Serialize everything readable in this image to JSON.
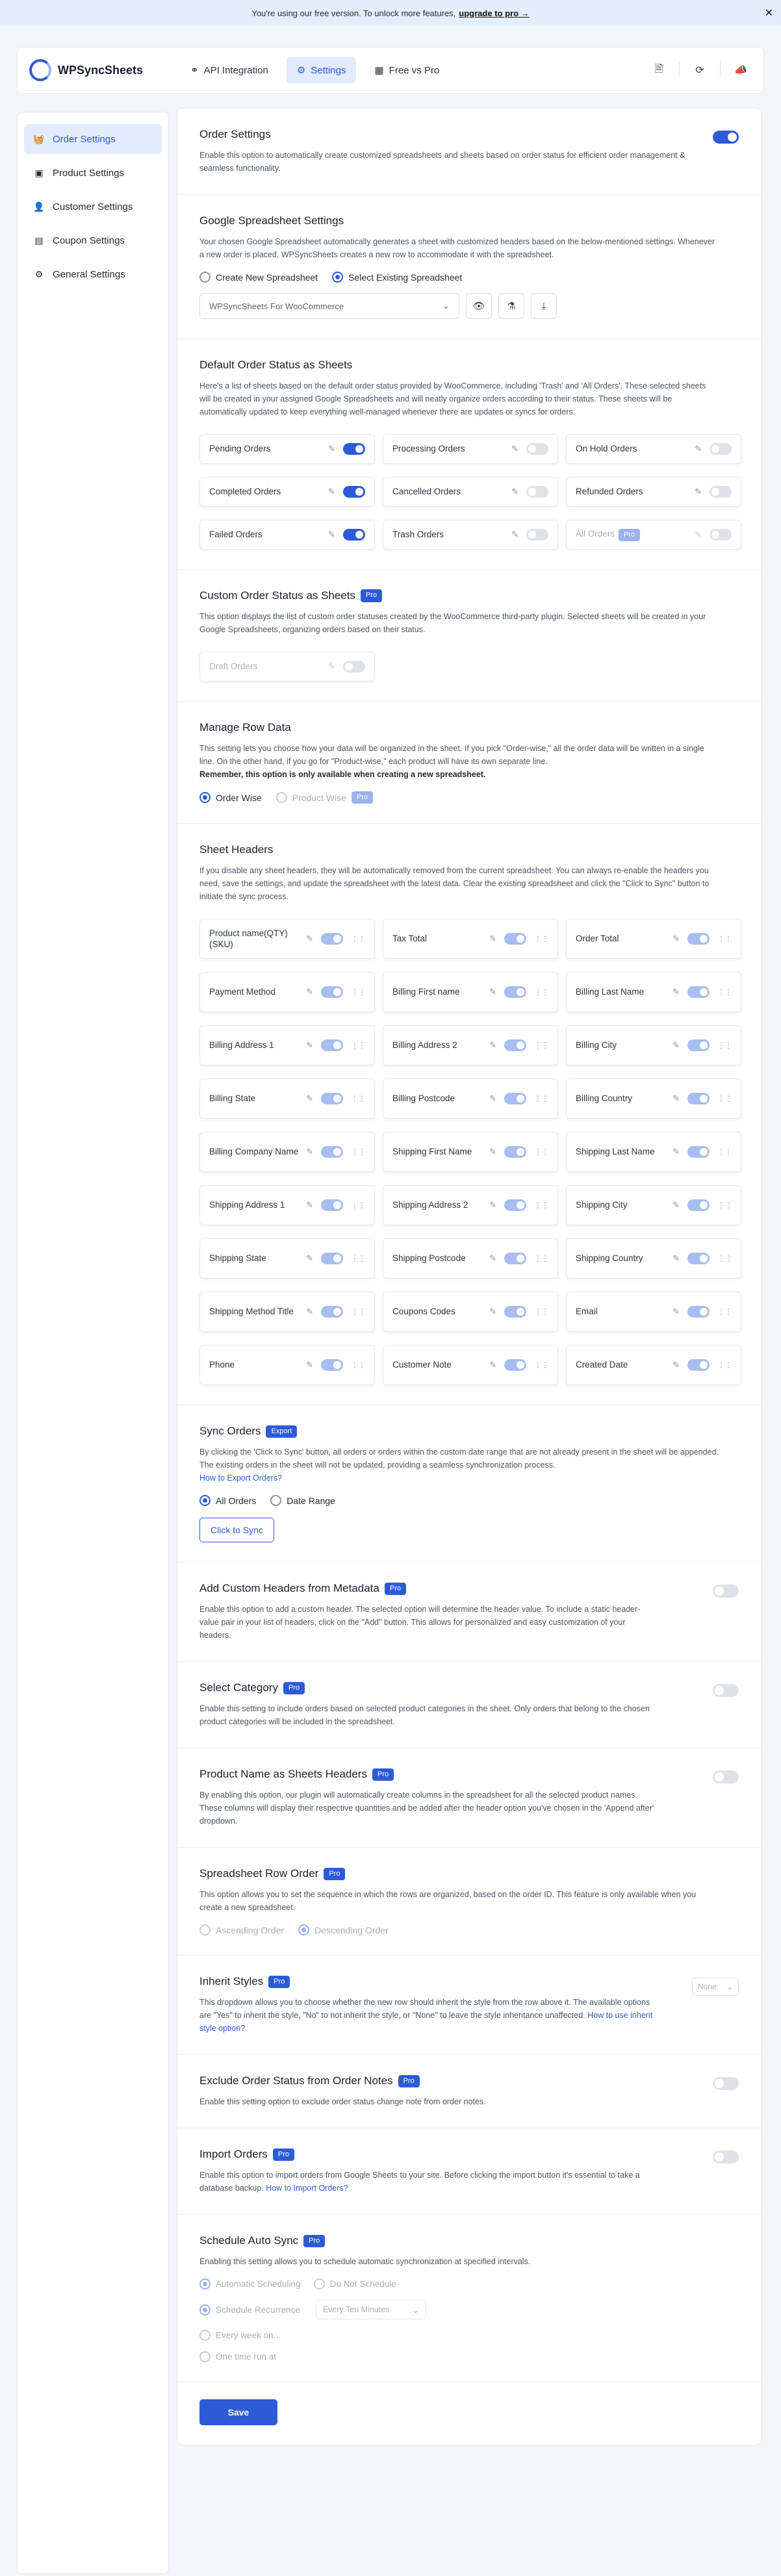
{
  "banner": {
    "text": "You're using our free version. To unlock more features,",
    "link": "upgrade to pro →",
    "close": "✕"
  },
  "app": {
    "name": "WPSyncSheets"
  },
  "nav": [
    {
      "label": "API Integration",
      "icon": "link-icon",
      "glyph": "⚭"
    },
    {
      "label": "Settings",
      "icon": "gear-icon",
      "glyph": "⚙"
    },
    {
      "label": "Free vs Pro",
      "icon": "grid-icon",
      "glyph": "▦"
    }
  ],
  "header_icons": [
    {
      "name": "document-icon",
      "glyph": "🗎"
    },
    {
      "name": "refresh-icon",
      "glyph": "⟳"
    },
    {
      "name": "megaphone-icon",
      "glyph": "📣"
    }
  ],
  "sidebar": [
    {
      "label": "Order Settings",
      "icon": "basket-icon",
      "glyph": "🧺"
    },
    {
      "label": "Product Settings",
      "icon": "product-icon",
      "glyph": "▣"
    },
    {
      "label": "Customer Settings",
      "icon": "user-icon",
      "glyph": "👤"
    },
    {
      "label": "Coupon Settings",
      "icon": "coupon-icon",
      "glyph": "▤"
    },
    {
      "label": "General Settings",
      "icon": "gear-icon",
      "glyph": "⚙"
    }
  ],
  "order_settings": {
    "title": "Order Settings",
    "desc": "Enable this option to automatically create customized spreadsheets and sheets based on order status for efficient order management & seamless functionality.",
    "enabled": true
  },
  "google": {
    "title": "Google Spreadsheet Settings",
    "desc": "Your chosen Google Spreadsheet automatically generates a sheet with customized headers based on the below-mentioned settings. Whenever a new order is placed, WPSyncSheets creates a new row to accommodate it with the spreadsheet.",
    "radio_new": "Create New Spreadsheet",
    "radio_existing": "Select Existing Spreadsheet",
    "selected": "WPSyncSheets For WooCommerce"
  },
  "default_status": {
    "title": "Default Order Status as Sheets",
    "desc": "Here's a list of sheets based on the default order status provided by WooCommerce, including 'Trash' and 'All Orders'. These selected sheets will be created in your assigned Google Spreadsheets and will neatly organize orders according to their status. These sheets will be automatically updated to keep everything well-managed whenever there are updates or syncs for orders.",
    "items": [
      {
        "label": "Pending Orders",
        "on": true
      },
      {
        "label": "Processing Orders",
        "on": false
      },
      {
        "label": "On Hold Orders",
        "on": false
      },
      {
        "label": "Completed Orders",
        "on": true
      },
      {
        "label": "Cancelled Orders",
        "on": false
      },
      {
        "label": "Refunded Orders",
        "on": false
      },
      {
        "label": "Failed Orders",
        "on": true
      },
      {
        "label": "Trash Orders",
        "on": false
      },
      {
        "label": "All Orders",
        "on": false,
        "pro": true
      }
    ]
  },
  "custom_status": {
    "title": "Custom Order Status as Sheets",
    "badge": "Pro",
    "desc": "This option displays the list of custom order statuses created by the WooCommerce third-party plugin. Selected sheets will be created in your Google Spreadsheets, organizing orders based on their status.",
    "item": "Draft Orders"
  },
  "row_data": {
    "title": "Manage Row Data",
    "desc": "This setting lets you choose how your data will be organized in the sheet. If you pick \"Order-wise,\" all the order data will be written in a single line. On the other hand, if you go for \"Product-wise,\" each product will have its own separate line.",
    "note": "Remember, this option is only available when creating a new spreadsheet.",
    "opt1": "Order Wise",
    "opt2": "Product Wise",
    "badge": "Pro"
  },
  "headers": {
    "title": "Sheet Headers",
    "desc": "If you disable any sheet headers, they will be automatically removed from the current spreadsheet. You can always re-enable the headers you need, save the settings, and update the spreadsheet with the latest data. Clear the existing spreadsheet and click the \"Click to Sync\" button to initiate the sync process.",
    "items": [
      "Product name(QTY)(SKU)",
      "Tax Total",
      "Order Total",
      "Payment Method",
      "Billing First name",
      "Billing Last Name",
      "Billing Address 1",
      "Billing Address 2",
      "Billing City",
      "Billing State",
      "Billing Postcode",
      "Billing Country",
      "Billing Company Name",
      "Shipping First Name",
      "Shipping Last Name",
      "Shipping Address 1",
      "Shipping Address 2",
      "Shipping City",
      "Shipping State",
      "Shipping Postcode",
      "Shipping Country",
      "Shipping Method Title",
      "Coupons Codes",
      "Email",
      "Phone",
      "Customer Note",
      "Created Date"
    ]
  },
  "sync": {
    "title": "Sync Orders",
    "badge": "Export",
    "desc": "By clicking the 'Click to Sync' button, all orders or orders within the custom date range that are not already present in the sheet will be appended. The existing orders in the sheet will not be updated, providing a seamless synchronization process.",
    "link": "How to Export Orders?",
    "opt1": "All Orders",
    "opt2": "Date Range",
    "button": "Click to Sync"
  },
  "metadata": {
    "title": "Add Custom Headers from Metadata",
    "badge": "Pro",
    "desc": "Enable this option to add a custom header. The selected option will determine the header value. To include a static header-value pair in your list of headers, click on the \"Add\" button. This allows for personalized and easy customization of your headers."
  },
  "category": {
    "title": "Select Category",
    "badge": "Pro",
    "desc": "Enable this setting to include orders based on selected product categories in the sheet. Only orders that belong to the chosen product categories will be included in the spreadsheet."
  },
  "product_headers": {
    "title": "Product Name as Sheets Headers",
    "badge": "Pro",
    "desc": "By enabling this option, our plugin will automatically create columns in the spreadsheet for all the selected product names. These columns will display their respective quantities and be added after the header option you've chosen in the 'Append after' dropdown."
  },
  "row_order": {
    "title": "Spreadsheet Row Order",
    "badge": "Pro",
    "desc": "This option allows you to set the sequence in which the rows are organized, based on the order ID. This feature is only available when you create a new spreadsheet.",
    "opt1": "Ascending Order",
    "opt2": "Descending Order"
  },
  "inherit": {
    "title": "Inherit Styles",
    "badge": "Pro",
    "desc": "This dropdown allows you to choose whether the new row should inherit the style from the row above it. The available options are \"Yes\" to inherit the style, \"No\" to not inherit the style, or \"None\" to leave the style inheritance unaffected.",
    "link": "How to use inherit style option?",
    "select": "None"
  },
  "exclude_notes": {
    "title": "Exclude Order Status from Order Notes",
    "badge": "Pro",
    "desc": "Enable this setting option to exclude order status change note from order notes."
  },
  "import": {
    "title": "Import Orders",
    "badge": "Pro",
    "desc": "Enable this option to import orders from Google Sheets to your site. Before clicking the import button it's essential to take a database backup.",
    "link": "How to Import Orders?"
  },
  "auto_sync": {
    "title": "Schedule Auto Sync",
    "badge": "Pro",
    "desc": "Enabling this setting allows you to schedule automatic synchronization at specified intervals.",
    "opt_auto": "Automatic Scheduling",
    "opt_none": "Do Not Schedule",
    "opt_recur": "Schedule Recurrence",
    "recur_value": "Every Ten Minutes",
    "opt_week": "Every week on...",
    "opt_once": "One time run at"
  },
  "save": "Save",
  "colors": {
    "accent": "#2d5bd8",
    "banner": "#e4eefb"
  }
}
